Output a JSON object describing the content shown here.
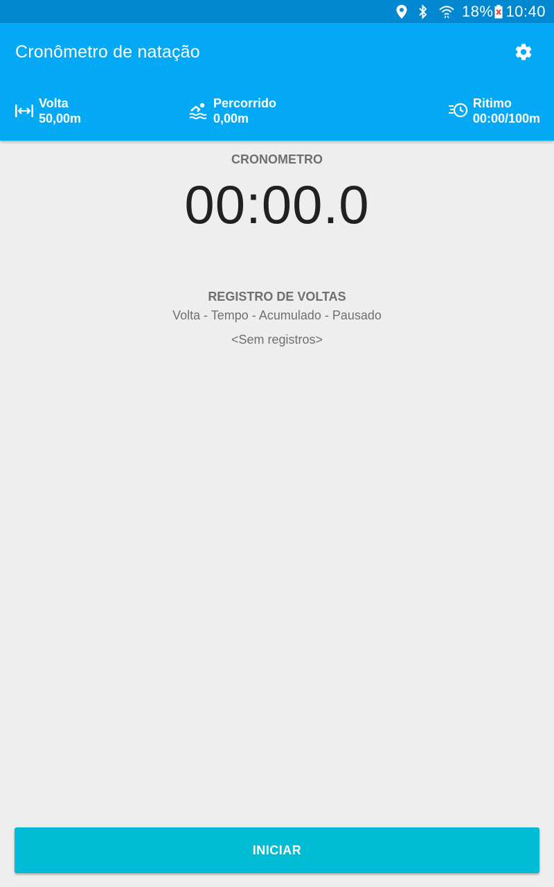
{
  "status_bar": {
    "battery": "18%",
    "time": "10:40",
    "icons": [
      "location-icon",
      "bluetooth-icon",
      "wifi-icon",
      "battery-icon"
    ]
  },
  "app_bar": {
    "title": "Cronômetro de natação",
    "settings_icon": "gear-icon",
    "background": "#03a9f4",
    "status_background": "#0288d1"
  },
  "stats": {
    "lap": {
      "label": "Volta",
      "value": "50,00m",
      "icon": "lap-length-icon"
    },
    "distance": {
      "label": "Percorrido",
      "value": "0,00m",
      "icon": "swimmer-icon"
    },
    "pace": {
      "label": "Ritimo",
      "value": "00:00/100m",
      "icon": "pace-clock-icon"
    }
  },
  "chronometer": {
    "label": "CRONOMETRO",
    "time": "00:00.0"
  },
  "laps": {
    "title": "REGISTRO DE VOLTAS",
    "columns": "Volta - Tempo - Acumulado - Pausado",
    "empty": "<Sem registros>"
  },
  "start_button": {
    "label": "INICIAR",
    "color": "#00bcd4"
  }
}
